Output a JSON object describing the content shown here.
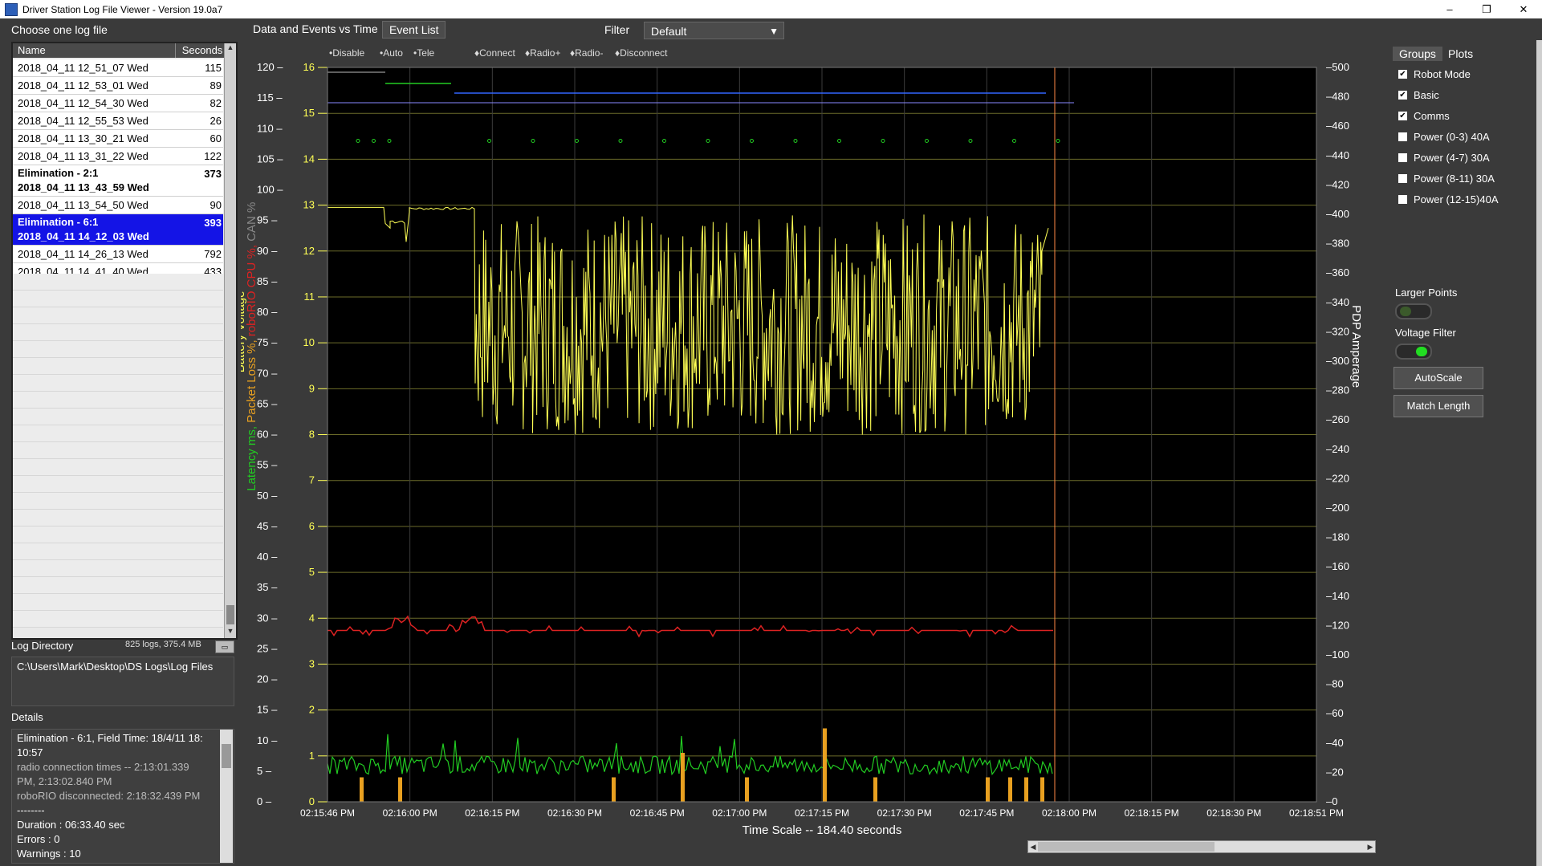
{
  "window": {
    "title": "Driver Station Log File Viewer - Version 19.0a7",
    "min": "–",
    "restore": "❐",
    "close": "✕"
  },
  "left": {
    "choose_label": "Choose one log file",
    "columns": {
      "name": "Name",
      "seconds": "Seconds"
    },
    "rows": [
      {
        "name": "2018_04_11 12_51_07 Wed",
        "seconds": "115"
      },
      {
        "name": "2018_04_11 12_53_01 Wed",
        "seconds": "89"
      },
      {
        "name": "2018_04_11 12_54_30 Wed",
        "seconds": "82"
      },
      {
        "name": "2018_04_11 12_55_53 Wed",
        "seconds": "26"
      },
      {
        "name": "2018_04_11 13_30_21 Wed",
        "seconds": "60"
      },
      {
        "name": "2018_04_11 13_31_22 Wed",
        "seconds": "122"
      }
    ],
    "match1": {
      "line1": "Elimination - 2:1",
      "line2": "2018_04_11 13_43_59 Wed",
      "seconds": "373"
    },
    "row_after1": {
      "name": "2018_04_11 13_54_50 Wed",
      "seconds": "90"
    },
    "match2": {
      "line1": "Elimination - 6:1",
      "line2": "2018_04_11 14_12_03 Wed",
      "seconds": "393"
    },
    "rows_tail": [
      {
        "name": "2018_04_11 14_26_13 Wed",
        "seconds": "792"
      },
      {
        "name": "2018_04_11 14_41_40 Wed",
        "seconds": "433"
      }
    ],
    "logdir_label": "Log Directory",
    "logdir_info": "825 logs, 375.4 MB",
    "logdir_path": "C:\\Users\\Mark\\Desktop\\DS Logs\\Log Files",
    "details_label": "Details",
    "details": {
      "l1": "Elimination - 6:1, Field Time: 18/4/11 18:",
      "l2": "10:57",
      "l3": "radio connection times --   2:13:01.339",
      "l4": "PM,   2:13:02.840 PM",
      "l5": "roboRIO disconnected:  2:18:32.439 PM",
      "l6": "--------",
      "l7": "Duration : 06:33.40 sec",
      "l8": "Errors : 0",
      "l9": "Warnings : 10"
    }
  },
  "tabs": {
    "data": "Data and Events vs Time",
    "events": "Event List",
    "filter_label": "Filter",
    "filter_value": "Default"
  },
  "right": {
    "tabs": {
      "groups": "Groups",
      "plots": "Plots"
    },
    "checks": [
      {
        "label": "Robot Mode",
        "checked": true
      },
      {
        "label": "Basic",
        "checked": true
      },
      {
        "label": "Comms",
        "checked": true
      },
      {
        "label": "Power (0-3) 40A",
        "checked": false
      },
      {
        "label": "Power (4-7) 30A",
        "checked": false
      },
      {
        "label": "Power (8-11) 30A",
        "checked": false
      },
      {
        "label": "Power (12-15)40A",
        "checked": false
      }
    ],
    "larger_points": "Larger Points",
    "voltage_filter": "Voltage Filter",
    "autoscale": "AutoScale",
    "match_length": "Match Length",
    "check_mark": "✔"
  },
  "chart_data": {
    "type": "line",
    "legend": [
      {
        "label": "Disable",
        "color": "#aaaaaa"
      },
      {
        "label": "Auto",
        "color": "#22cc22"
      },
      {
        "label": "Tele",
        "color": "#3388ff"
      },
      {
        "label": "Connect",
        "color": "#22cc22"
      },
      {
        "label": "Radio+",
        "color": "#ffff44"
      },
      {
        "label": "Radio-",
        "color": "#ffff44"
      },
      {
        "label": "Disconnect",
        "color": "#ff8844"
      }
    ],
    "legend_marks": {
      "dot": "•",
      "diamond": "♦"
    },
    "x_ticks": [
      "02:15:46 PM",
      "02:16:00 PM",
      "02:16:15 PM",
      "02:16:30 PM",
      "02:16:45 PM",
      "02:17:00 PM",
      "02:17:15 PM",
      "02:17:30 PM",
      "02:17:45 PM",
      "02:18:00 PM",
      "02:18:15 PM",
      "02:18:30 PM",
      "02:18:51 PM"
    ],
    "xlabel": "Time Scale -- 184.40 seconds",
    "y_left_outer": {
      "ticks": [
        "120",
        "115",
        "110",
        "105",
        "100",
        "95",
        "90",
        "85",
        "80",
        "75",
        "70",
        "65",
        "60",
        "55",
        "50",
        "45",
        "40",
        "35",
        "30",
        "25",
        "20",
        "15",
        "10",
        "5",
        "0"
      ]
    },
    "y_left_inner": {
      "ticks": [
        "16",
        "15",
        "14",
        "13",
        "12",
        "11",
        "10",
        "9",
        "8",
        "7",
        "6",
        "5",
        "4",
        "3",
        "2",
        "1",
        "0"
      ]
    },
    "y_right": {
      "label": "PDP Amperage",
      "ticks": [
        "500",
        "480",
        "460",
        "440",
        "420",
        "400",
        "380",
        "360",
        "340",
        "320",
        "300",
        "280",
        "260",
        "240",
        "220",
        "200",
        "180",
        "160",
        "140",
        "120",
        "100",
        "80",
        "60",
        "40",
        "20",
        "0"
      ]
    },
    "y_left_labels": {
      "latency": "Latency ms,",
      "packet": "Packet Loss %,",
      "cpu": "roboRIO CPU %,",
      "can": "CAN %",
      "battery": "Battery Voltage"
    },
    "series": [
      {
        "name": "Battery Voltage",
        "color": "#ffff55",
        "approx_range": [
          7.5,
          13
        ]
      },
      {
        "name": "roboRIO CPU %",
        "color": "#dd2222",
        "approx_level": 28
      },
      {
        "name": "Latency ms",
        "color": "#22cc22",
        "approx_level": 6
      },
      {
        "name": "Packet Loss %",
        "color": "#e8a020",
        "approx_max": 12
      }
    ],
    "colors": {
      "bg": "#000000",
      "grid": "#6b6b2a",
      "vgrid": "#3c3c3c",
      "axis": "#ffffff"
    }
  }
}
